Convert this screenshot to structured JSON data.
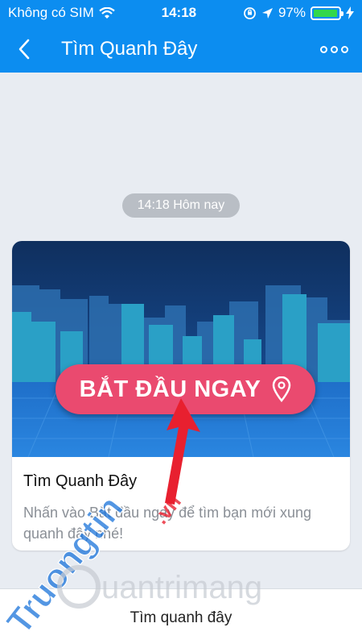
{
  "status_bar": {
    "carrier": "Không có SIM",
    "time": "14:18",
    "battery_percent": "97%",
    "battery_level": 0.97
  },
  "nav": {
    "title": "Tìm Quanh Đây"
  },
  "chat": {
    "timestamp": "14:18 Hôm nay"
  },
  "card": {
    "button_label": "BẮT ĐẦU NGAY",
    "title": "Tìm Quanh Đây",
    "description": "Nhấn vào Bắt đầu ngay để tìm bạn mới xung quanh đây nhé!"
  },
  "bottom_bar": {
    "label": "Tìm quanh đây"
  },
  "watermark": {
    "primary": "Truongtin",
    "secondary": "uantrimang"
  },
  "colors": {
    "header_blue": "#0c8df0",
    "start_button": "#ea4a6f",
    "arrow_red": "#e8202f",
    "battery_green": "#32d74b"
  }
}
